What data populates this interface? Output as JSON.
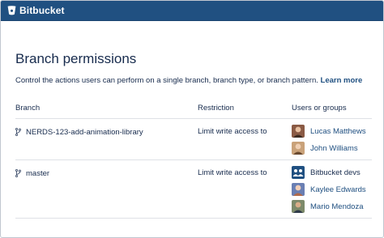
{
  "app": {
    "name": "Bitbucket",
    "brand_color": "#205081"
  },
  "page": {
    "title": "Branch permissions",
    "description": "Control the actions users can perform on a single branch, branch type, or branch pattern.",
    "learn_more": "Learn more"
  },
  "table": {
    "headers": {
      "branch": "Branch",
      "restriction": "Restriction",
      "users": "Users or groups"
    },
    "rows": [
      {
        "branch": "NERDS-123-add-animation-library",
        "restriction": "Limit write access to",
        "users": [
          {
            "name": "Lucas Matthews",
            "type": "user",
            "avatar_color": "#8a5a44"
          },
          {
            "name": "John Williams",
            "type": "user",
            "avatar_color": "#c9a27a"
          }
        ]
      },
      {
        "branch": "master",
        "restriction": "Limit write access to",
        "users": [
          {
            "name": "Bitbucket devs",
            "type": "group",
            "avatar_color": "#205081"
          },
          {
            "name": "Kaylee Edwards",
            "type": "user",
            "avatar_color": "#6a7fb3"
          },
          {
            "name": "Mario Mendoza",
            "type": "user",
            "avatar_color": "#7d8a6a"
          }
        ]
      }
    ]
  },
  "icons": {
    "branch": "branch-icon",
    "logo": "bitbucket-logo-icon",
    "group": "group-icon"
  }
}
